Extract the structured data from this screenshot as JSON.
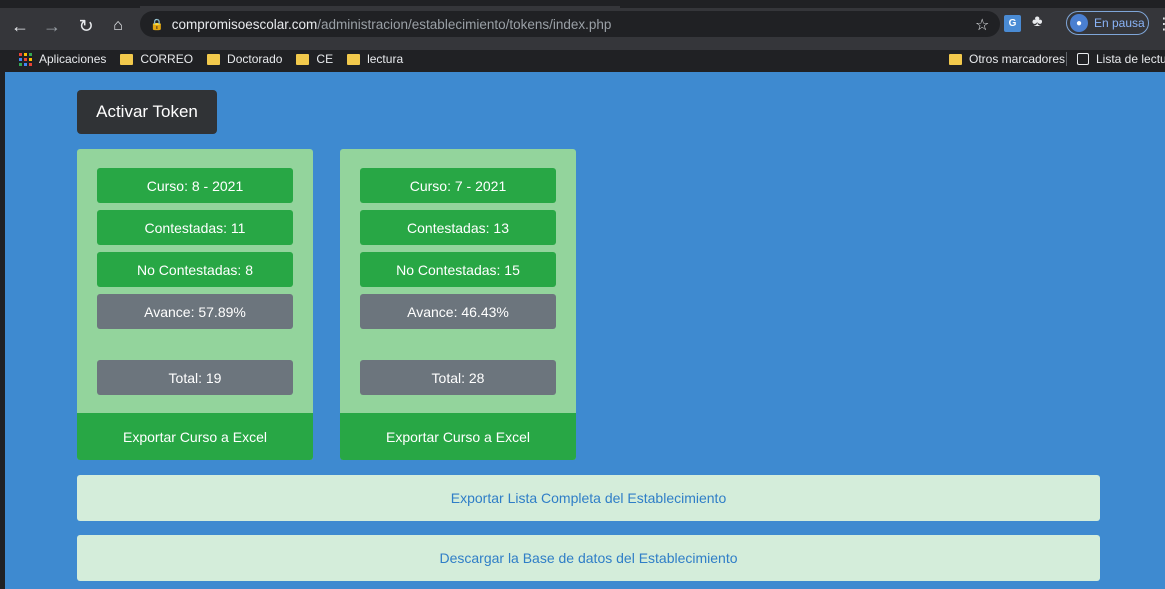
{
  "browser": {
    "url_host": "compromisoescolar.com",
    "url_path": "/administracion/establecimiento/tokens/index.php",
    "profile_label": "En pausa",
    "bookmarks": [
      "Aplicaciones",
      "CORREO",
      "Doctorado",
      "CE",
      "lectura"
    ],
    "bookmarks_right": [
      "Otros marcadores",
      "Lista de lectura"
    ]
  },
  "page": {
    "activate_label": "Activar Token",
    "cards": [
      {
        "curso": "Curso: 8 - 2021",
        "contestadas": "Contestadas: 11",
        "no_contestadas": "No Contestadas: 8",
        "avance": "Avance: 57.89%",
        "total": "Total: 19",
        "export": "Exportar Curso a Excel"
      },
      {
        "curso": "Curso: 7 - 2021",
        "contestadas": "Contestadas: 13",
        "no_contestadas": "No Contestadas: 15",
        "avance": "Avance: 46.43%",
        "total": "Total: 28",
        "export": "Exportar Curso a Excel"
      }
    ],
    "export_all_label": "Exportar Lista Completa del Establecimiento",
    "download_db_label": "Descargar la Base de datos del Establecimiento"
  },
  "colors": {
    "page_bg": "#3e8ad0",
    "card_bg": "#93d49c",
    "success": "#28a745",
    "secondary": "#6c757d",
    "light_success": "#d4edda",
    "link": "#2f7ec7"
  }
}
